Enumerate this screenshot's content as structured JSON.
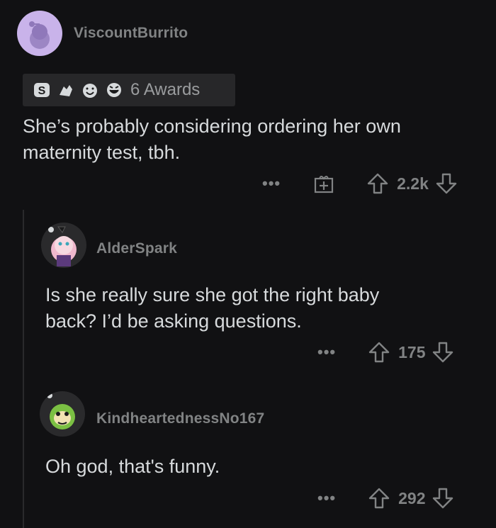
{
  "comments": [
    {
      "username": "ViscountBurrito",
      "awards_label": "6 Awards",
      "body_lines": [
        "She’s probably considering ordering her own",
        "maternity test, tbh."
      ],
      "more_label": "•••",
      "votes": "2.2k",
      "avatar_color": "#c9b3ea"
    },
    {
      "username": "AlderSpark",
      "body_lines": [
        "Is she really sure she got the right baby",
        "back? I’d be asking questions."
      ],
      "more_label": "•••",
      "votes": "175",
      "avatar_color": "#f0c7d5"
    },
    {
      "username": "KindheartednessNo167",
      "body_lines": [
        "Oh god, that's funny."
      ],
      "more_label": "•••",
      "votes": "292",
      "avatar_color": "#7bc043"
    }
  ],
  "icons": {
    "more": "more-options-icon",
    "gift": "give-award-icon",
    "upvote": "upvote-arrow-icon",
    "downvote": "downvote-arrow-icon"
  }
}
